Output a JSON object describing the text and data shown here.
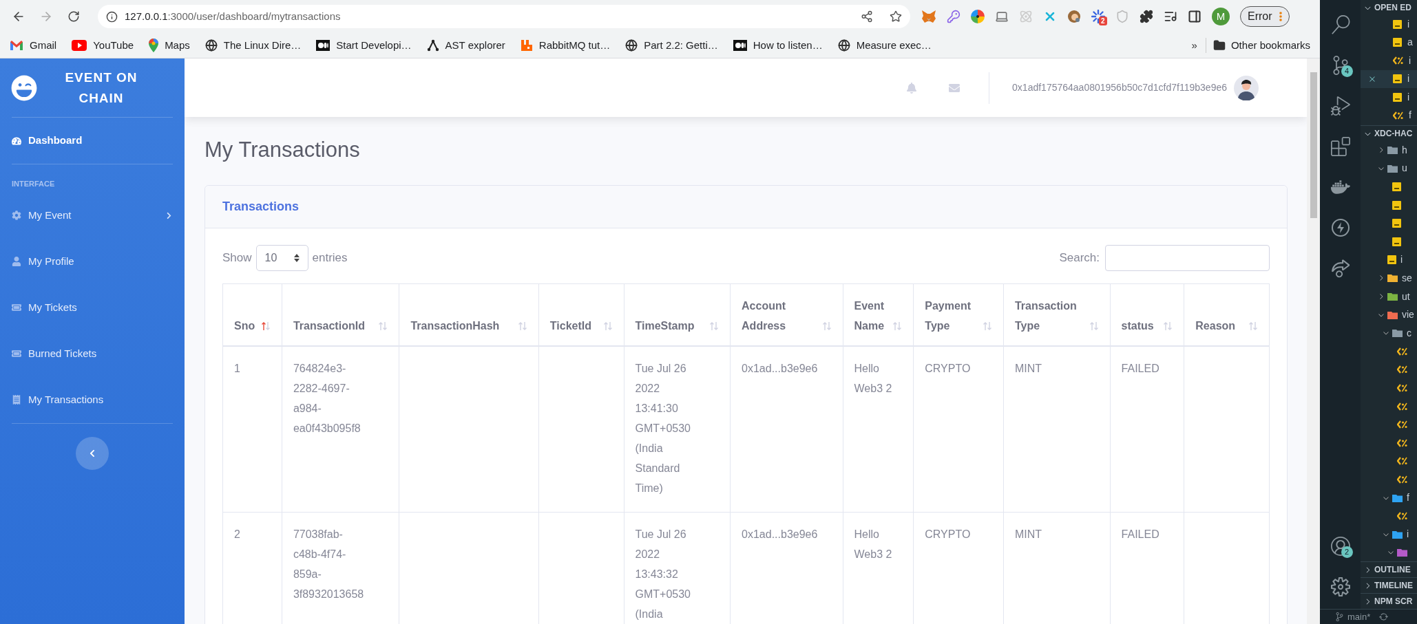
{
  "browser": {
    "url_host": "127.0.0.1",
    "url_path": ":3000/user/dashboard/mytransactions",
    "extension_badge": "2",
    "profile_initial": "M",
    "error_button": "Error",
    "bookmarks": [
      {
        "label": "Gmail"
      },
      {
        "label": "YouTube"
      },
      {
        "label": "Maps"
      },
      {
        "label": "The Linux Dire…"
      },
      {
        "label": "Start Developi…"
      },
      {
        "label": "AST explorer"
      },
      {
        "label": "RabbitMQ tut…"
      },
      {
        "label": "Part 2.2: Getti…"
      },
      {
        "label": "How to listen…"
      },
      {
        "label": "Measure exec…"
      }
    ],
    "bookmarks_overflow": "»",
    "other_bookmarks": "Other bookmarks"
  },
  "sidebar": {
    "brand": "EVENT ON CHAIN",
    "top_items": [
      {
        "label": "Dashboard",
        "selected": true,
        "submenu": false
      }
    ],
    "heading": "INTERFACE",
    "items": [
      {
        "label": "My Event",
        "selected": false,
        "submenu": true
      },
      {
        "label": "My Profile",
        "selected": false,
        "submenu": false
      },
      {
        "label": "My Tickets",
        "selected": false,
        "submenu": false
      },
      {
        "label": "Burned Tickets",
        "selected": false,
        "submenu": false
      },
      {
        "label": "My Transactions",
        "selected": false,
        "submenu": false
      }
    ]
  },
  "topbar": {
    "account": "0x1adf175764aa0801956b50c7d1cfd7f119b3e9e6"
  },
  "page_title": "My Transactions",
  "card": {
    "title": "Transactions",
    "show_label": "Show",
    "page_size": "10",
    "entries_label": "entries",
    "search_label": "Search:",
    "columns": [
      {
        "label": "Sno",
        "sorted": true
      },
      {
        "label": "TransactionId",
        "sorted": false
      },
      {
        "label": "TransactionHash",
        "sorted": false
      },
      {
        "label": "TicketId",
        "sorted": false
      },
      {
        "label": "TimeStamp",
        "sorted": false
      },
      {
        "label": "Account Address",
        "sorted": false
      },
      {
        "label": "Event Name",
        "sorted": false
      },
      {
        "label": "Payment Type",
        "sorted": false
      },
      {
        "label": "Transaction Type",
        "sorted": false
      },
      {
        "label": "status",
        "sorted": false
      },
      {
        "label": "Reason",
        "sorted": false
      }
    ],
    "rows": [
      [
        "1",
        "764824e3-2282-4697-a984-ea0f43b095f8",
        "",
        "",
        "Tue Jul 26 2022 13:41:30 GMT+0530 (India Standard Time)",
        "0x1ad...b3e9e6",
        "Hello Web3 2",
        "CRYPTO",
        "MINT",
        "FAILED",
        ""
      ],
      [
        "2",
        "77038fab-c48b-4f74-859a-3f8932013658",
        "",
        "",
        "Tue Jul 26 2022 13:43:32 GMT+0530 (India",
        "0x1ad...b3e9e6",
        "Hello Web3 2",
        "CRYPTO",
        "MINT",
        "FAILED",
        ""
      ]
    ]
  },
  "editor": {
    "source_control_badge": "4",
    "accounts_badge": "2",
    "branch": "main*",
    "open_editors": {
      "title": "OPEN ED",
      "expanded": true,
      "files": [
        {
          "kind": "js",
          "label": "i",
          "selected": false
        },
        {
          "kind": "js",
          "label": "a",
          "selected": false
        },
        {
          "kind": "ejs",
          "label": "i",
          "selected": false
        },
        {
          "kind": "js",
          "label": "i",
          "selected": true
        },
        {
          "kind": "js",
          "label": "i",
          "selected": false
        },
        {
          "kind": "ejs",
          "label": "f",
          "selected": false
        }
      ]
    },
    "project": {
      "title": "XDC-HAC",
      "expanded": true,
      "tree": [
        {
          "children": [
            {
              "kind": "folder",
              "label": "h",
              "color": "#8a9aa5",
              "expanded": false
            },
            {
              "kind": "folder",
              "label": "u",
              "color": "#8a9aa5",
              "expanded": true,
              "children": [
                {
                  "kind": "js"
                },
                {
                  "kind": "js"
                },
                {
                  "kind": "js"
                },
                {
                  "kind": "js"
                }
              ]
            },
            {
              "kind": "js",
              "label": "i"
            }
          ]
        },
        {
          "kind": "folder",
          "label": "se",
          "color": "#f0b232",
          "expanded": false
        },
        {
          "kind": "folder",
          "label": "ut",
          "color": "#7cb342",
          "expanded": false
        },
        {
          "kind": "folder",
          "label": "vie",
          "color": "#ef6c50",
          "expanded": true,
          "children": [
            {
              "kind": "folder",
              "label": "c",
              "color": "#8a9aa5",
              "expanded": true,
              "children": [
                {
                  "kind": "ejs"
                },
                {
                  "kind": "ejs"
                },
                {
                  "kind": "ejs"
                },
                {
                  "kind": "ejs"
                },
                {
                  "kind": "ejs"
                },
                {
                  "kind": "ejs"
                },
                {
                  "kind": "ejs"
                },
                {
                  "kind": "ejs"
                }
              ]
            },
            {
              "kind": "folder",
              "label": "f",
              "color": "#2ea3f2",
              "expanded": true,
              "children": [
                {
                  "kind": "ejs"
                }
              ]
            },
            {
              "kind": "folder",
              "label": "i",
              "color": "#2ea3f2",
              "expanded": true,
              "children": [
                {
                  "kind": "folder",
                  "color": "#b45ac8",
                  "expanded": true
                }
              ]
            }
          ]
        }
      ]
    },
    "sections": [
      {
        "title": "OUTLINE",
        "expanded": false
      },
      {
        "title": "TIMELINE",
        "expanded": false
      },
      {
        "title": "NPM SCR",
        "expanded": false
      }
    ]
  }
}
